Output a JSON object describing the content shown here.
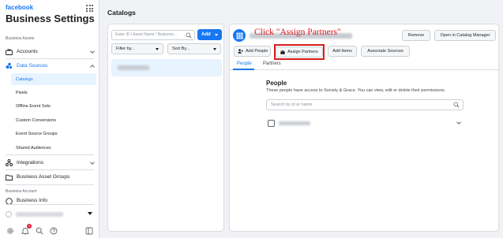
{
  "brand": "facebook",
  "app_title": "Business Settings",
  "sidebar": {
    "section_assets": "Business Assets",
    "accounts": "Accounts",
    "data_sources": "Data Sources",
    "sub_items": [
      "Catalogs",
      "Pixels",
      "Offline Event Sets",
      "Custom Conversions",
      "Event Source Groups",
      "Shared Audiences"
    ],
    "integrations": "Integrations",
    "asset_groups": "Business Asset Groups",
    "section_account": "Business Account",
    "business_info": "Business Info",
    "notification_count": "1"
  },
  "page_title": "Catalogs",
  "list_panel": {
    "search_placeholder": "Enter ID / Asset Name / Business...",
    "add_label": "Add",
    "filter_label": "Filter by...",
    "sort_label": "Sort By..."
  },
  "detail": {
    "annotation": "Click \"Assign Partners\"",
    "remove_label": "Remove",
    "open_label": "Open in Catalog Manager",
    "add_people": "Add People",
    "assign_partners": "Assign Partners",
    "add_items": "Add Items",
    "associate_sources": "Associate Sources",
    "tabs": [
      "People",
      "Partners"
    ],
    "section_title": "People",
    "section_desc": "These people have access to Society & Grace. You can view, edit or delete their permissions.",
    "people_search_placeholder": "Search by id or name"
  },
  "colors": {
    "primary": "#1877f2",
    "annotation": "#e0191d",
    "highlight": "#d91e1e"
  }
}
